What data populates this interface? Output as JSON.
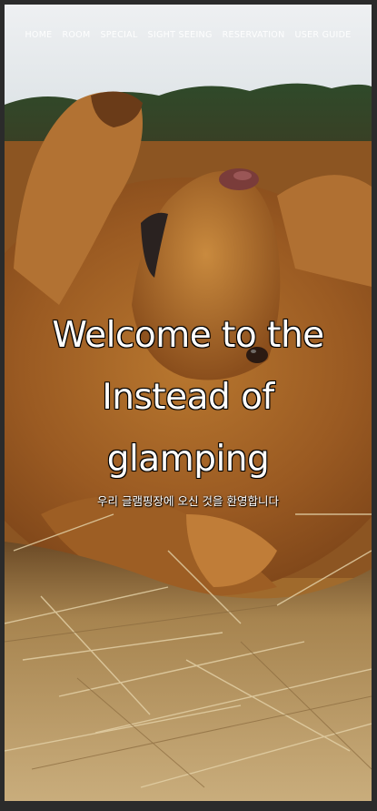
{
  "nav": {
    "items": [
      {
        "label": "HOME"
      },
      {
        "label": "ROOM"
      },
      {
        "label": "SPECIAL"
      },
      {
        "label": "SIGHT SEEING"
      },
      {
        "label": "RESERVATION"
      },
      {
        "label": "USER GUIDE"
      }
    ]
  },
  "hero": {
    "headline_line1": "Welcome to the",
    "headline_line2": "Instead of",
    "headline_line3": "glamping",
    "subhead": "우리 글램핑장에 오신 것을 환영합니다"
  },
  "colors": {
    "frame": "#2b2b2b",
    "fur": "#a5682a",
    "sky": "#e9edf0",
    "text": "#ffffff"
  },
  "icons": {
    "background": "dog-photo-background"
  }
}
